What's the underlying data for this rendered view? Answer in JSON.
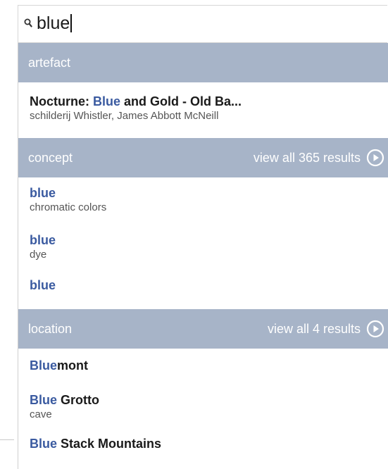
{
  "search": {
    "value": "blue"
  },
  "colors": {
    "header_bg": "#a7b4c8",
    "highlight": "#3a5aa0"
  },
  "sections": {
    "artefact": {
      "title": "artefact",
      "items": [
        {
          "hl": "",
          "pre": "Nocturne: ",
          "mid": "Blue",
          "post": " and Gold - Old Ba...",
          "sub": "schilderij Whistler, James Abbott McNeill"
        }
      ]
    },
    "concept": {
      "title": "concept",
      "view_all": "view all 365 results",
      "items": [
        {
          "hl": "blue",
          "rest": "",
          "sub": "chromatic colors"
        },
        {
          "hl": "blue",
          "rest": "",
          "sub": "dye"
        },
        {
          "hl": "blue",
          "rest": "",
          "sub": ""
        }
      ]
    },
    "location": {
      "title": "location",
      "view_all": "view all 4 results",
      "items": [
        {
          "hl": "Blue",
          "rest": "mont",
          "sub": ""
        },
        {
          "hl": "Blue",
          "rest": " Grotto",
          "sub": "cave"
        },
        {
          "hl": "Blue",
          "rest": " Stack Mountains",
          "sub": ""
        }
      ]
    }
  }
}
